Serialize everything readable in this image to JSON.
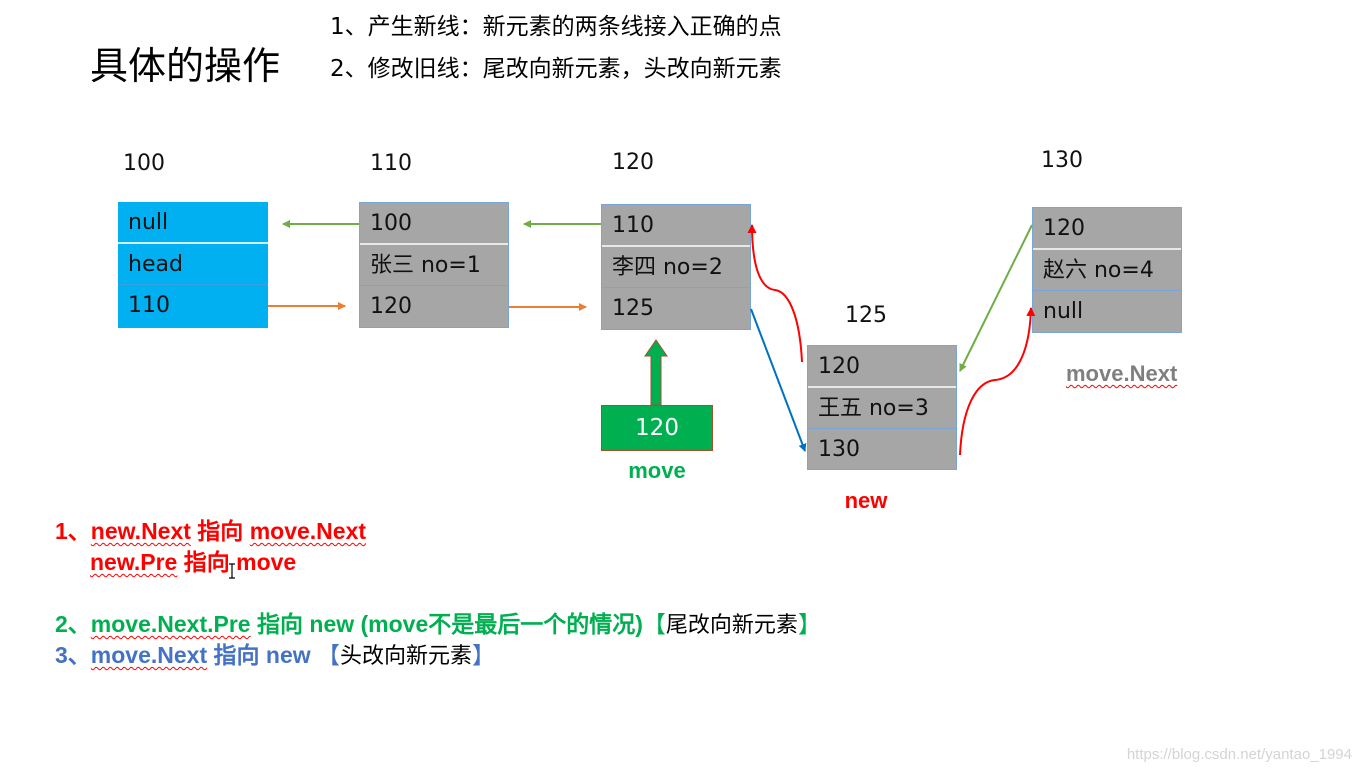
{
  "title": "具体的操作",
  "steps": [
    "1、产生新线：新元素的两条线接入正确的点",
    "2、修改旧线：尾改向新元素，头改向新元素"
  ],
  "nodes": {
    "head": {
      "address": "100",
      "cells": [
        "null",
        "head",
        "110"
      ],
      "color": "#00b0f0"
    },
    "zhangsan": {
      "address": "110",
      "cells": [
        "100",
        "张三 no=1",
        "120"
      ],
      "color": "#a6a6a6"
    },
    "lisi": {
      "address": "120",
      "cells": [
        "110",
        "李四 no=2",
        "125"
      ],
      "color": "#a6a6a6"
    },
    "wangwu": {
      "address": "125",
      "cells": [
        "120",
        "王五 no=3",
        "130"
      ],
      "color": "#a6a6a6"
    },
    "zhaoliu": {
      "address": "130",
      "cells": [
        "120",
        "赵六 no=4",
        "null"
      ],
      "color": "#a6a6a6"
    }
  },
  "pointers": {
    "move": {
      "value": "120",
      "label": "move",
      "color": "#00b050"
    },
    "new": {
      "label": "new",
      "color": "#ff0000"
    },
    "move_next": {
      "label": "move.Next",
      "color": "#7f7f7f"
    }
  },
  "link_colors": {
    "prev": "#70ad47",
    "next": "#ed7d31",
    "new_link": "#ff0000",
    "move_next_link": "#0070c0"
  },
  "notes": {
    "n1": {
      "num": "1、",
      "a": "new.Next",
      "b": " 指向 ",
      "c": "move.Next"
    },
    "n1b": {
      "a": "new.Pre",
      "b": " 指向 move"
    },
    "n2": {
      "num": "2、",
      "a": "move.Next.Pre",
      "b": " 指向 new (move不是最后一个的情况)",
      "lb": "【",
      "text": "尾改向新元素",
      "rb": "】"
    },
    "n3": {
      "num": "3、",
      "a": "move.Next",
      "b": " 指向 new ",
      "lb": "【",
      "text": "头改向新元素",
      "rb": "】"
    }
  },
  "watermark": "https://blog.csdn.net/yantao_1994"
}
